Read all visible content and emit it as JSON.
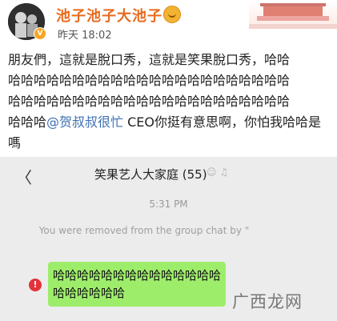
{
  "post": {
    "username": "池子池子大池子",
    "timestamp": "昨天 18:02",
    "text_lines": [
      "朋友們，這就是脫口秀，這就是笑果脫口秀，哈哈",
      "哈哈哈哈哈哈哈哈哈哈哈哈哈哈哈哈哈哈哈哈哈哈",
      "哈哈哈哈哈哈哈哈哈哈哈哈哈哈哈哈哈哈哈哈哈哈"
    ],
    "text_prefix": "哈哈哈",
    "mention": "@贺叔叔很忙",
    "text_suffix": " CEO你挺有意思啊，你怕我哈哈是嗎"
  },
  "chat": {
    "title": "笑果艺人大家庭 (55)",
    "time": "5:31 PM",
    "system_message": "You were removed from the group chat by \"",
    "bubble_text": "哈哈哈哈哈哈哈哈哈哈哈哈哈哈哈哈哈哈哈哈",
    "error_symbol": "!"
  },
  "watermark": "广西龙网",
  "icons": {
    "avatar": "avatar-icon",
    "verified": "verified-badge-icon",
    "back": "back-arrow-icon",
    "mute": "mute-icon",
    "error": "error-icon"
  },
  "colors": {
    "username": "#e86a1e",
    "mention": "#3e6fb1",
    "bubble": "#9ded6b",
    "error": "#e4323b"
  }
}
